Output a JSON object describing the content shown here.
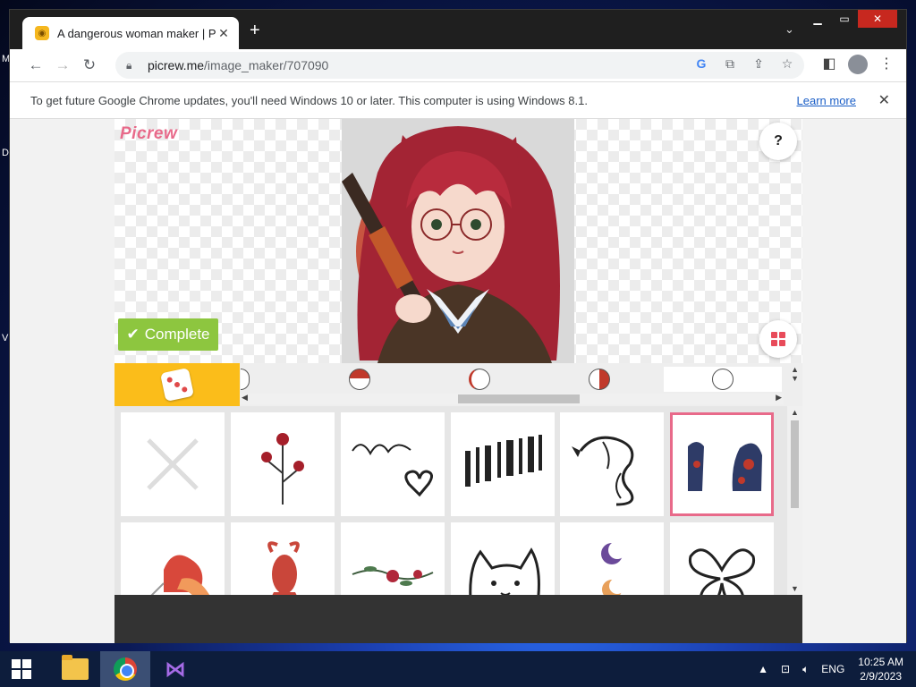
{
  "desktop": {
    "edge_letters": [
      "M",
      "D",
      "V"
    ]
  },
  "browser": {
    "tab_title": "A dangerous woman maker | Picrew",
    "url_host": "picrew.me",
    "url_path": "/image_maker/707090",
    "info_message": "To get future Google Chrome updates, you'll need Windows 10 or later. This computer is using Windows 8.1.",
    "learn_more": "Learn more"
  },
  "picrew": {
    "logo": "Picrew",
    "help": "?",
    "complete_label": "Complete",
    "complete_color": "#8dc63f",
    "accent_color": "#fbbd1a",
    "selected_item_index": 5,
    "items": [
      {
        "name": "none"
      },
      {
        "name": "rose-tattoo"
      },
      {
        "name": "script-heart-tattoo"
      },
      {
        "name": "barcode-tattoo"
      },
      {
        "name": "dragon-tattoo"
      },
      {
        "name": "sleeve-tattoo"
      },
      {
        "name": "heart-rainbow-tattoo"
      },
      {
        "name": "goldfish-tattoo"
      },
      {
        "name": "vine-flower-tattoo"
      },
      {
        "name": "cat-tattoo"
      },
      {
        "name": "moon-tattoo"
      },
      {
        "name": "butterfly-tattoo"
      }
    ]
  },
  "taskbar": {
    "language": "ENG",
    "time": "10:25 AM",
    "date": "2/9/2023"
  }
}
